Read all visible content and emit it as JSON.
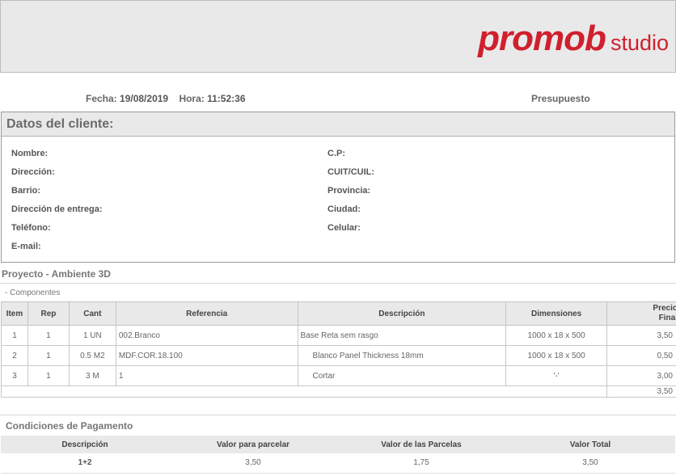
{
  "logo": {
    "main": "promob",
    "sub": "studio"
  },
  "header": {
    "fecha_label": "Fecha:",
    "fecha_value": "19/08/2019",
    "hora_label": "Hora:",
    "hora_value": "11:52:36",
    "doc_type": "Presupuesto"
  },
  "client": {
    "title": "Datos del cliente:",
    "left_fields": [
      "Nombre:",
      "Dirección:",
      "Barrio:",
      "Dirección de entrega:",
      "Teléfono:",
      "E-mail:"
    ],
    "right_fields": [
      "C.P:",
      "CUIT/CUIL:",
      "Provincia:",
      "Ciudad:",
      "Celular:"
    ]
  },
  "project": {
    "title": "Proyecto - Ambiente 3D",
    "section": "- Componentes"
  },
  "items_table": {
    "headers": [
      "Item",
      "Rep",
      "Cant",
      "Referencia",
      "Descripción",
      "Dimensiones",
      "Precio Final"
    ],
    "header_price_line1": "Precio",
    "header_price_line2": "Final",
    "rows": [
      {
        "item": "1",
        "rep": "1",
        "cant": "1 UN",
        "ref": "002.Branco",
        "desc": "Base Reta sem rasgo",
        "dim": "1000 x 18 x 500",
        "price": "3,50"
      },
      {
        "item": "2",
        "rep": "1",
        "cant": "0.5 M2",
        "ref": "MDF.COR.18.100",
        "desc": "Blanco Panel Thickness 18mm",
        "dim": "1000 x 18 x 500",
        "price": "0,50"
      },
      {
        "item": "3",
        "rep": "1",
        "cant": "3 M",
        "ref": "1",
        "desc": "Cortar",
        "dim": "'-'",
        "price": "3,00"
      }
    ],
    "total": "3,50"
  },
  "payment": {
    "title": "Condiciones de Pagamento",
    "headers": [
      "Descripción",
      "Valor para parcelar",
      "Valor de las Parcelas",
      "Valor Total"
    ],
    "row": [
      "1+2",
      "3,50",
      "1,75",
      "3,50"
    ]
  },
  "colors": {
    "brand": "#d0202e",
    "header_bg": "#e9e9e9"
  }
}
